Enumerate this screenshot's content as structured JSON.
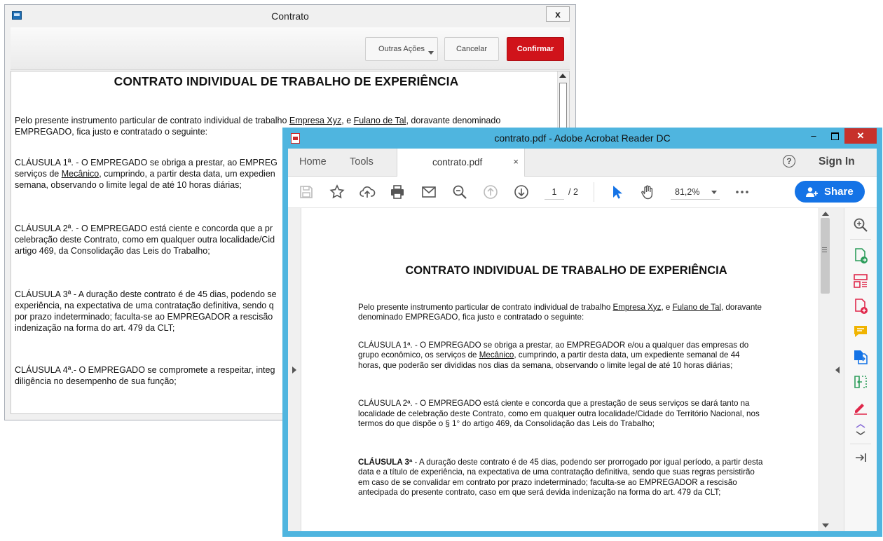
{
  "contrato_window": {
    "title": "Contrato",
    "close_label": "x",
    "buttons": {
      "outras": "Outras Ações",
      "cancelar": "Cancelar",
      "confirmar": "Confirmar"
    }
  },
  "contract": {
    "title": "CONTRATO INDIVIDUAL DE TRABALHO DE EXPERIÊNCIA",
    "intro": {
      "a": "Pelo presente instrumento particular de contrato individual de trabalho ",
      "empresa": "Empresa Xyz",
      "b": ", e ",
      "empregado": "Fulano de Tal",
      "c": ", doravante denominado EMPREGADO, fica justo e contratado o seguinte:"
    },
    "c1": {
      "head": "CLÁUSULA 1ª.",
      "a": " - O EMPREGADO se obriga a prestar, ao EMPREGADOR e/ou a qualquer das empresas do grupo econômico, os serviços de ",
      "cargo": "Mecânico",
      "b": ", cumprindo, a partir desta data, um expediente semanal de 44 horas, que poderão ser divididas nos dias da semana, observando o limite legal de até 10 horas diárias;"
    },
    "c2": {
      "head": "CLÁUSULA 2ª.",
      "body": " - O EMPREGADO está ciente e concorda que a prestação de seus serviços se dará tanto na localidade de celebração deste Contrato, como em qualquer outra localidade/Cidade do Território Nacional, nos termos do que dispõe o § 1° do artigo 469, da Consolidação das Leis do Trabalho;"
    },
    "c3": {
      "head": "CLÁUSULA 3ª",
      "body": " - A duração deste contrato é de 45 dias, podendo ser prorrogado por igual período, a partir desta data e a título de experiência, na expectativa de uma contratação definitiva, sendo que suas regras persistirão em caso de se convalidar em contrato por prazo indeterminado; faculta-se ao EMPREGADOR a rescisão antecipada do presente contrato, caso em que será devida indenização na forma do art. 479 da CLT;"
    },
    "c4": {
      "head": "CLÁUSULA 4ª.",
      "body": "- O EMPREGADO se compromete a respeitar, integralmente, as normas e regulamentos da empresa, agindo com zelo e diligência no desempenho de sua função;"
    }
  },
  "left_doc_visible": {
    "c1_line1": "CLÁUSULA 1ª. - O EMPREGADO se obriga a prestar, ao EMPREG",
    "c1_line2a": "serviços de ",
    "c1_line2b": ", cumprindo, a partir desta data, um expedien",
    "c1_line3": "semana, observando o limite legal de até 10 horas diárias;",
    "c2_line1": "CLÁUSULA 2ª. - O EMPREGADO está ciente e concorda que a pr",
    "c2_line2": "celebração deste Contrato, como em qualquer outra localidade/Cid",
    "c2_line3": "artigo 469, da Consolidação das Leis do Trabalho;",
    "c3_line1": "CLÁUSULA 3ª - A duração deste contrato é de 45 dias, podendo se",
    "c3_line2": "experiência, na expectativa de uma contratação definitiva, sendo q",
    "c3_line3": "por prazo indeterminado; faculta-se ao EMPREGADOR a rescisão",
    "c3_line4": "indenização na forma do art. 479 da CLT;",
    "c4_line1": "CLÁUSULA 4ª.- O EMPREGADO se compromete a respeitar, integ",
    "c4_line2": "diligência no desempenho de sua função;"
  },
  "acrobat_window": {
    "title": "contrato.pdf - Adobe Acrobat Reader DC",
    "tabs": {
      "home": "Home",
      "tools": "Tools",
      "doc": "contrato.pdf",
      "doc_close": "×"
    },
    "help": "?",
    "sign_in": "Sign In",
    "page_current": "1",
    "page_total": "/ 2",
    "zoom": "81,2%",
    "share": "Share",
    "colors": {
      "titlebar": "#4fb5df",
      "close": "#c7312b",
      "share": "#1473e6",
      "tool_blue": "#1473e6",
      "tool_red": "#e0284b",
      "tool_green": "#2d9d5b",
      "tool_yellow": "#f0b400"
    },
    "toolbar_icons": [
      "save-icon",
      "bookmark-star-icon",
      "upload-cloud-icon",
      "print-icon",
      "email-icon",
      "zoom-out-icon",
      "page-up-icon",
      "page-down-icon",
      "select-cursor-icon",
      "hand-tool-icon",
      "more-icon"
    ],
    "right_panel_icons": [
      "zoom-tools-icon",
      "export-pdf-icon",
      "organize-pages-icon",
      "create-pdf-icon",
      "comment-icon",
      "combine-files-icon",
      "compress-icon",
      "fill-sign-icon",
      "collapse-panel-icon",
      "expand-panel-icon"
    ]
  }
}
